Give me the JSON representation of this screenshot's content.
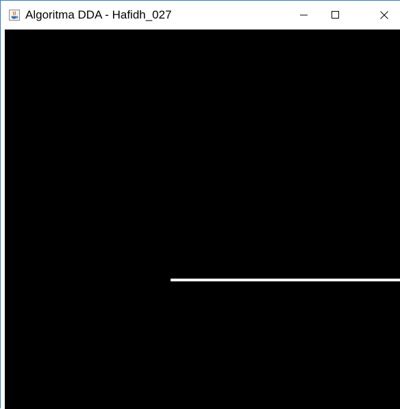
{
  "window": {
    "title": "Algoritma DDA - Hafidh_027",
    "app_icon": "java-icon",
    "controls": {
      "minimize_icon": "minimize-icon",
      "maximize_icon": "maximize-icon",
      "close_icon": "close-icon"
    }
  },
  "canvas": {
    "background_color": "#000000",
    "line_color": "#ffffff"
  }
}
